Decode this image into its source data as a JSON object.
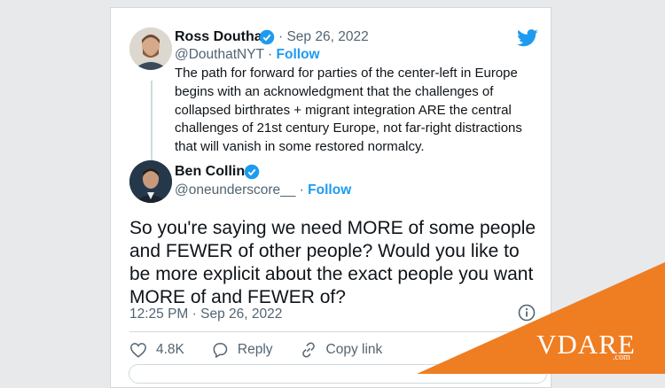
{
  "quoted_tweet": {
    "author_name": "Ross Douthat",
    "date": "· Sep 26, 2022",
    "handle": "@DouthatNYT",
    "dot": " · ",
    "follow_label": "Follow",
    "text": "The path for forward for parties of the center-left in Europe begins with an acknowledgment that the challenges of collapsed birthrates + migrant integration ARE the central challenges of 21st century Europe, not far-right distractions that will vanish in some restored normalcy."
  },
  "reply_tweet": {
    "author_name": "Ben Collins",
    "handle": "@oneunderscore__",
    "dot": " · ",
    "follow_label": "Follow",
    "text": "So you're saying we need MORE of some people and FEWER of other people? Would you like to be more explicit about the exact people you want MORE of and FEWER of?",
    "timestamp": "12:25 PM · Sep 26, 2022"
  },
  "actions": {
    "like_count": "4.8K",
    "reply_label": "Reply",
    "copy_link_label": "Copy link"
  },
  "watermark": {
    "brand": "VDARE",
    "domain": ".com"
  },
  "colors": {
    "accent": "#1d9bf0",
    "banner_orange": "#ef7d22",
    "text": "#0f1419",
    "muted": "#536471"
  },
  "icons": [
    "twitter-bird-icon",
    "verified-badge-icon",
    "heart-icon",
    "reply-icon",
    "link-icon",
    "info-icon"
  ]
}
